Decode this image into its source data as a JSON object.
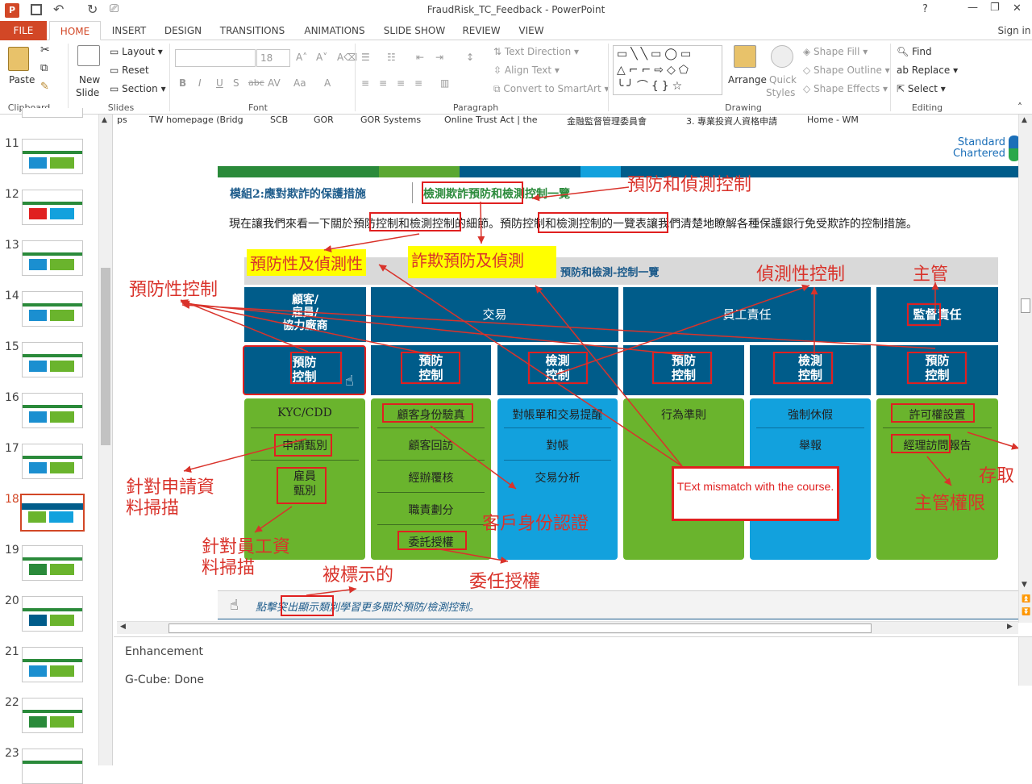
{
  "title_bar": {
    "title": "FraudRisk_TC_Feedback - PowerPoint",
    "help": "?",
    "minimize": "—",
    "restore": "❐",
    "close": "✕",
    "sign_in": "Sign in"
  },
  "tabs": [
    "FILE",
    "HOME",
    "INSERT",
    "DESIGN",
    "TRANSITIONS",
    "ANIMATIONS",
    "SLIDE SHOW",
    "REVIEW",
    "VIEW"
  ],
  "ribbon": {
    "clipboard": {
      "label": "Clipboard",
      "paste": "Paste"
    },
    "slides": {
      "label": "Slides",
      "new_slide": "New",
      "new_slide2": "Slide",
      "layout": "Layout",
      "reset": "Reset",
      "section": "Section"
    },
    "font": {
      "label": "Font",
      "size": "18"
    },
    "paragraph": {
      "label": "Paragraph",
      "text_direction": "Text Direction",
      "align_text": "Align Text",
      "convert": "Convert to SmartArt"
    },
    "drawing": {
      "label": "Drawing",
      "arrange": "Arrange",
      "quick": "Quick",
      "styles": "Styles",
      "fill": "Shape Fill",
      "outline": "Shape Outline",
      "effects": "Shape Effects"
    },
    "editing": {
      "label": "Editing",
      "find": "Find",
      "replace": "Replace",
      "select": "Select"
    }
  },
  "thumbnails": [
    "11",
    "12",
    "13",
    "14",
    "15",
    "16",
    "17",
    "18",
    "19",
    "20",
    "21",
    "22",
    "23"
  ],
  "bookmarks": [
    "ps",
    "TW homepage (Bridg",
    "SCB",
    "GOR",
    "GOR Systems",
    "Online Trust Act | the",
    "金融監督管理委員會",
    "3. 專業投資人資格申請",
    "Home - WM"
  ],
  "slide": {
    "logo_line1": "Standard",
    "logo_line2": "Chartered",
    "module_title": "模組2:應對欺詐的保護措施",
    "section_title": "檢測欺詐預防和檢測",
    "section_suffix": "控制一覽",
    "intro": "現在讓我們來看一下關於預防控制和檢測控制的細節。預防控制和檢測控制的一覽表讓我們清楚地瞭解各種保護銀行免受欺詐的控制措施。",
    "table_title": "預防和檢測-控制一覽",
    "headers": [
      "顧客/\n雇員/\n協力廠商",
      "交易",
      "員工責任",
      "監督責任"
    ],
    "controls": [
      "預防\n控制",
      "預防\n控制",
      "檢測\n控制",
      "預防\n控制",
      "檢測\n控制",
      "預防\n控制"
    ],
    "col1": [
      "KYC/CDD",
      "申請甄別",
      "雇員\n甄別"
    ],
    "col2": [
      "顧客身份驗真",
      "顧客回訪",
      "經辦覆核",
      "職責劃分",
      "委託授權"
    ],
    "col3": [
      "對帳單和交易提醒",
      "對帳",
      "交易分析"
    ],
    "col4": [
      "行為準則"
    ],
    "col5": [
      "強制休假",
      "舉報"
    ],
    "col6": [
      "許可權設置",
      "經理訪問報告"
    ],
    "footer": "點擊突出顯示類別學習更多關於預防/檢測控制。",
    "callout": "TExt mismatch with the course."
  },
  "annotations": {
    "a1": "預防和偵測控制",
    "a2": "預防性及偵測性",
    "a3": "詐欺預防及偵測",
    "a4": "偵測性控制",
    "a5": "主管",
    "a6": "預防性控制",
    "a7": "針對申請資\n料掃描",
    "a8": "針對員工資\n料掃描",
    "a9": "被標示的",
    "a10": "客戶身份認證",
    "a11": "委任授權",
    "a12": "主管權限",
    "a13": "存取"
  },
  "notes": {
    "line1": "Enhancement",
    "line2": "G-Cube: Done"
  },
  "colors": {
    "accent": "#d24726",
    "header_blue": "#005c8a",
    "green": "#6ab42d",
    "light_blue": "#12a1dd",
    "red": "#e02020"
  }
}
